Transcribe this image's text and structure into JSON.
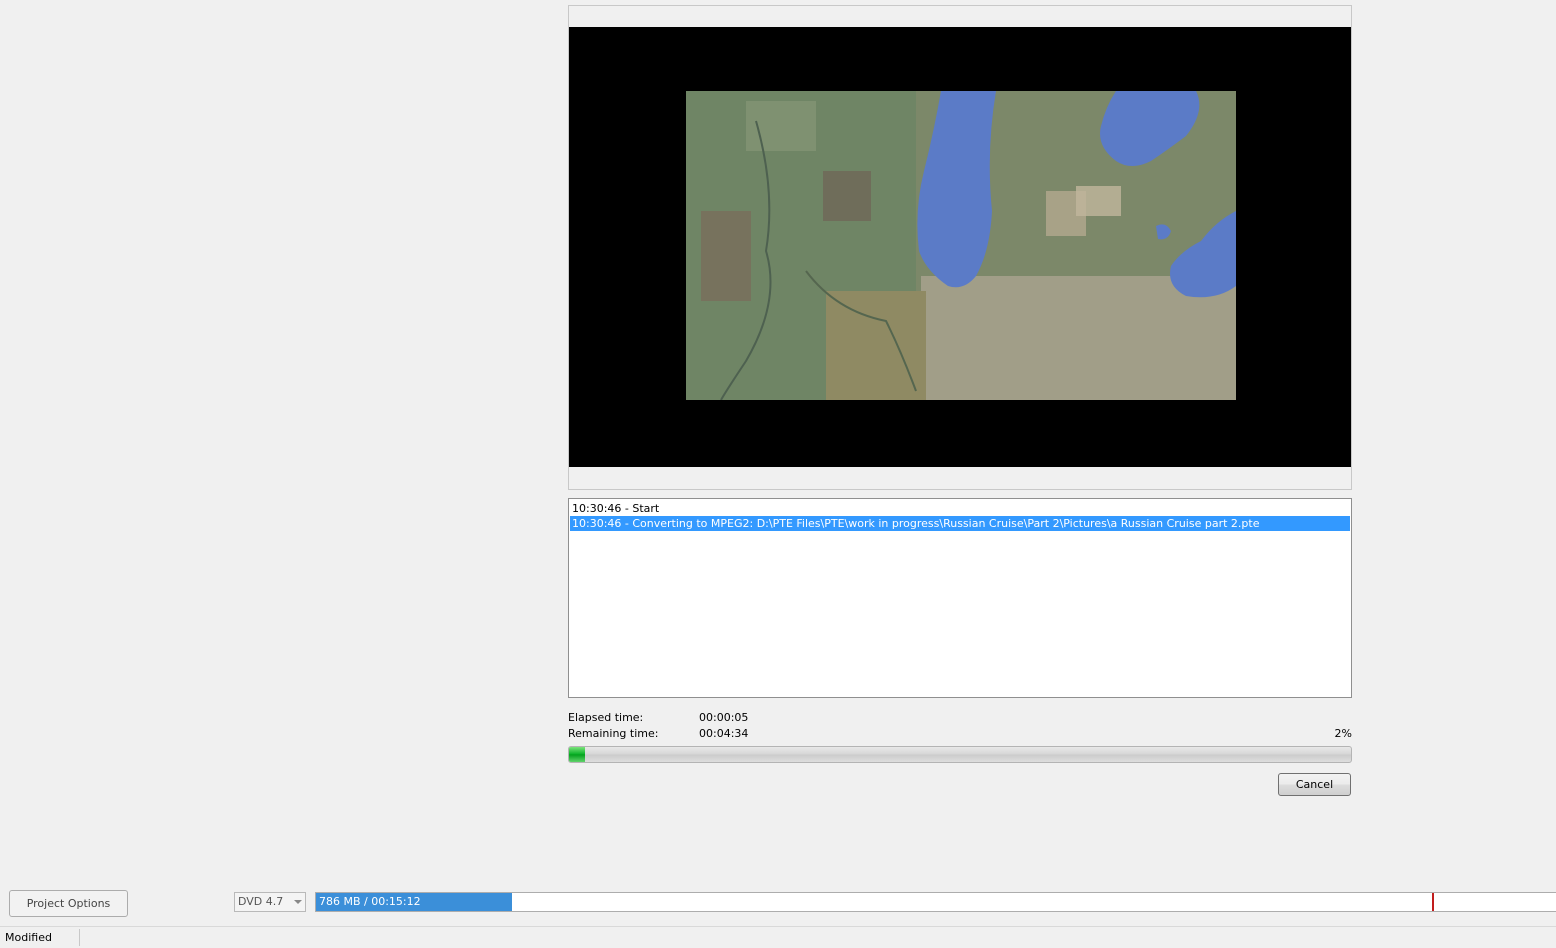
{
  "log": {
    "lines": [
      "10:30:46 - Start",
      "10:30:46 - Converting to MPEG2: D:\\PTE Files\\PTE\\work in progress\\Russian Cruise\\Part 2\\Pictures\\a Russian Cruise part 2.pte"
    ],
    "selected_index": 1
  },
  "timing": {
    "elapsed_label": "Elapsed time:",
    "elapsed_value": "00:00:05",
    "remaining_label": "Remaining time:",
    "remaining_value": "00:04:34",
    "percent_text": "2%"
  },
  "progress": {
    "fraction": 0.02
  },
  "buttons": {
    "cancel": "Cancel",
    "project_options": "Project Options"
  },
  "disc": {
    "selected": "DVD 4.7",
    "usage_text": "786 MB / 00:15:12",
    "usage_fraction": 0.158,
    "limit_fraction": 0.9
  },
  "status": {
    "text": "Modified"
  },
  "colors": {
    "selection": "#3399ff",
    "progress_green": "#06b025",
    "usage_blue": "#3b8fd9",
    "limit_marker": "#c11d1d"
  }
}
